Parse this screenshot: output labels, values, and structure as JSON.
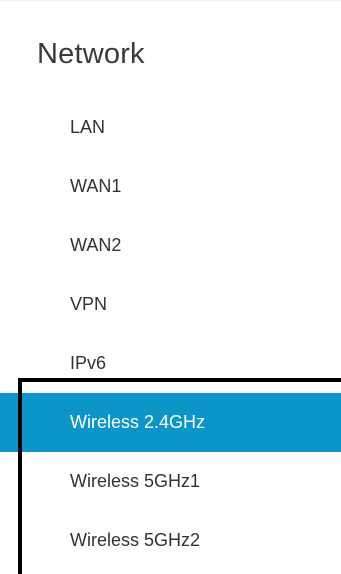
{
  "section": {
    "title": "Network"
  },
  "nav": {
    "items": [
      {
        "label": "LAN"
      },
      {
        "label": "WAN1"
      },
      {
        "label": "WAN2"
      },
      {
        "label": "VPN"
      },
      {
        "label": "IPv6"
      },
      {
        "label": "Wireless 2.4GHz",
        "active": true
      },
      {
        "label": "Wireless 5GHz1"
      },
      {
        "label": "Wireless 5GHz2"
      }
    ]
  },
  "colors": {
    "active_background": "#0b95c9",
    "active_text": "#ffffff",
    "text": "#333333",
    "annotation_border": "#000000"
  }
}
